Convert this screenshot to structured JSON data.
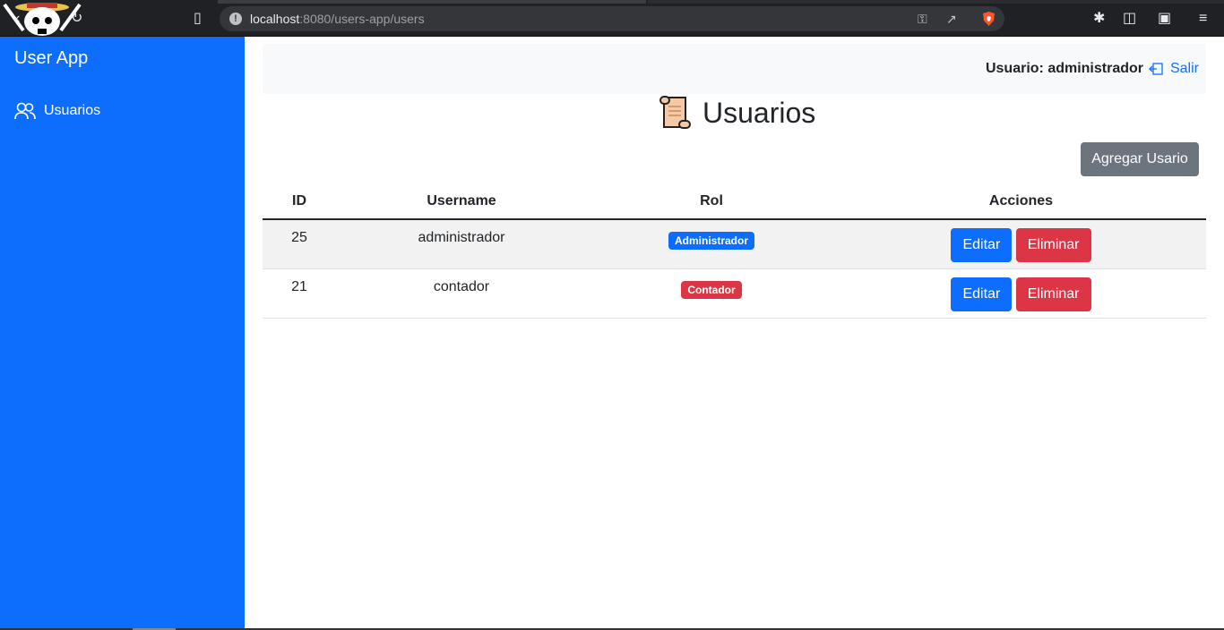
{
  "browser": {
    "url_host": "localhost",
    "url_path": ":8080/users-app/users",
    "icons": [
      "back-icon",
      "reload-icon",
      "bookmark-icon",
      "info-icon",
      "key-icon",
      "share-icon",
      "brave-shield-icon",
      "extensions-icon",
      "sidebar-icon",
      "wallet-icon",
      "menu-icon"
    ]
  },
  "sidebar": {
    "brand": "User App",
    "items": [
      {
        "label": "Usuarios",
        "icon": "users-icon"
      }
    ]
  },
  "navbar": {
    "user_label": "Usuario: administrador",
    "logout_label": "Salir"
  },
  "page": {
    "title": "Usuarios",
    "add_button": "Agregar Usario"
  },
  "table": {
    "headers": [
      "ID",
      "Username",
      "Rol",
      "Acciones"
    ],
    "rows": [
      {
        "id": "25",
        "username": "administrador",
        "rol": "Administrador",
        "rol_color": "#0d6efd",
        "edit": "Editar",
        "delete": "Eliminar"
      },
      {
        "id": "21",
        "username": "contador",
        "rol": "Contador",
        "rol_color": "#dc3545",
        "edit": "Editar",
        "delete": "Eliminar"
      }
    ]
  },
  "colors": {
    "primary": "#0d6efd",
    "danger": "#dc3545",
    "secondary": "#6c757d"
  }
}
